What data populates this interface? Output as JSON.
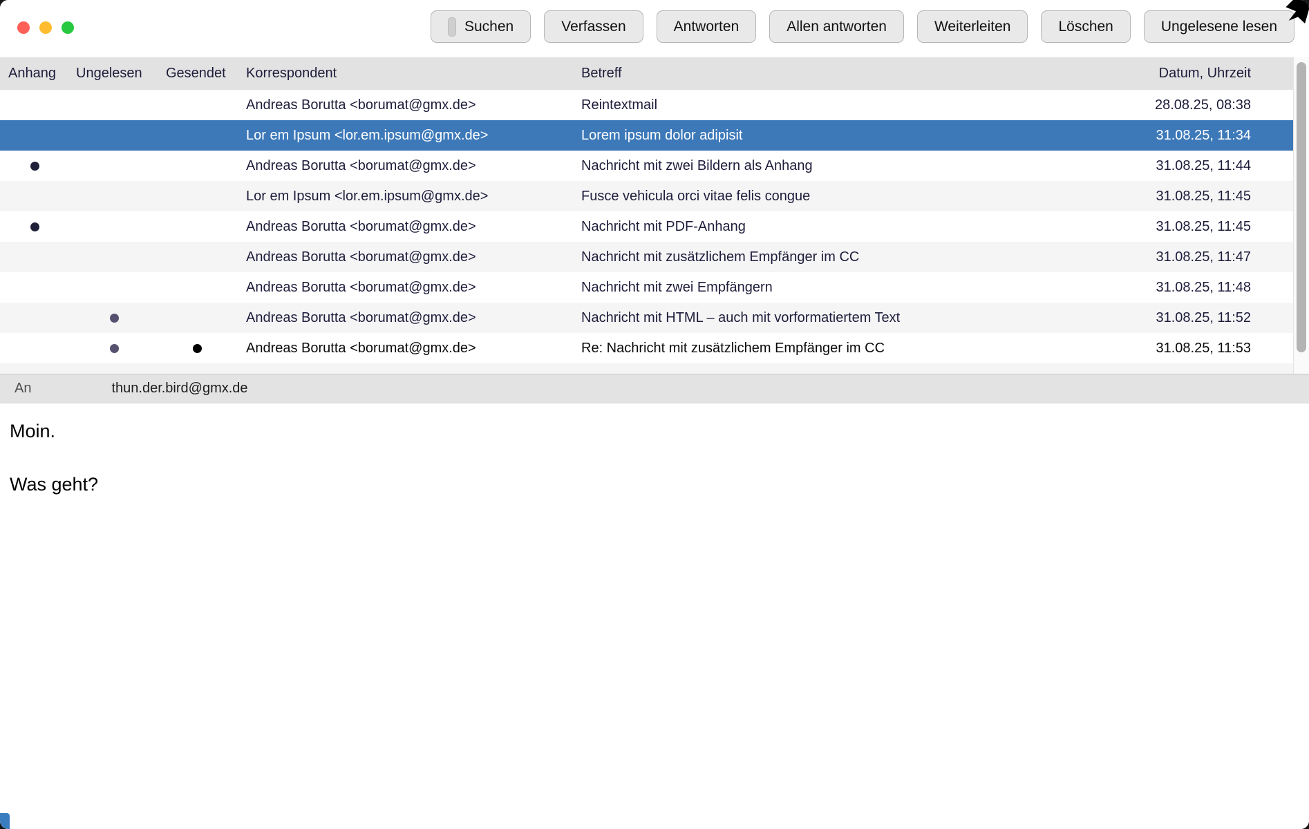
{
  "colors": {
    "selected_row": "#3d79b9",
    "header_bg": "#e2e2e2",
    "alt_row_bg": "#f5f5f6",
    "row_text": "#1d1d3b",
    "button_bg": "#e9e9e9",
    "traffic_red": "#ff5f57",
    "traffic_yellow": "#febc2e",
    "traffic_green": "#28c840",
    "unread_dot": "#55516e",
    "attachment_dot": "#20203a",
    "sent_dot": "#000000"
  },
  "toolbar": {
    "buttons": [
      {
        "id": "suchen",
        "label": "Suchen",
        "has_icon": true
      },
      {
        "id": "verfassen",
        "label": "Verfassen",
        "has_icon": false
      },
      {
        "id": "antworten",
        "label": "Antworten",
        "has_icon": false
      },
      {
        "id": "allen-antworten",
        "label": "Allen antworten",
        "has_icon": false
      },
      {
        "id": "weiterleiten",
        "label": "Weiterleiten",
        "has_icon": false
      },
      {
        "id": "loeschen",
        "label": "Löschen",
        "has_icon": false
      },
      {
        "id": "ungelesene-lesen",
        "label": "Ungelesene lesen",
        "has_icon": false
      }
    ]
  },
  "message_list": {
    "columns": [
      {
        "id": "anhang",
        "label": "Anhang"
      },
      {
        "id": "ungelesen",
        "label": "Ungelesen"
      },
      {
        "id": "gesendet",
        "label": "Gesendet"
      },
      {
        "id": "korrespondent",
        "label": "Korrespondent"
      },
      {
        "id": "betreff",
        "label": "Betreff"
      },
      {
        "id": "datum",
        "label": "Datum, Uhrzeit"
      }
    ],
    "rows": [
      {
        "anhang": false,
        "ungelesen": false,
        "gesendet": false,
        "korrespondent": "Andreas Borutta <borumat@gmx.de>",
        "betreff": "Reintextmail",
        "datum": "28.08.25, 08:38",
        "selected": false,
        "sent_style": false
      },
      {
        "anhang": false,
        "ungelesen": false,
        "gesendet": false,
        "korrespondent": "Lor em Ipsum <lor.em.ipsum@gmx.de>",
        "betreff": "Lorem ipsum dolor adipisit",
        "datum": "31.08.25, 11:34",
        "selected": true,
        "sent_style": false
      },
      {
        "anhang": true,
        "ungelesen": false,
        "gesendet": false,
        "korrespondent": "Andreas Borutta <borumat@gmx.de>",
        "betreff": "Nachricht mit zwei Bildern als Anhang",
        "datum": "31.08.25, 11:44",
        "selected": false,
        "sent_style": false
      },
      {
        "anhang": false,
        "ungelesen": false,
        "gesendet": false,
        "korrespondent": "Lor em Ipsum <lor.em.ipsum@gmx.de>",
        "betreff": "Fusce vehicula orci vitae felis congue",
        "datum": "31.08.25, 11:45",
        "selected": false,
        "sent_style": false
      },
      {
        "anhang": true,
        "ungelesen": false,
        "gesendet": false,
        "korrespondent": "Andreas Borutta <borumat@gmx.de>",
        "betreff": "Nachricht mit PDF-Anhang",
        "datum": "31.08.25, 11:45",
        "selected": false,
        "sent_style": false
      },
      {
        "anhang": false,
        "ungelesen": false,
        "gesendet": false,
        "korrespondent": "Andreas Borutta <borumat@gmx.de>",
        "betreff": "Nachricht mit zusätzlichem Empfänger im CC",
        "datum": "31.08.25, 11:47",
        "selected": false,
        "sent_style": false
      },
      {
        "anhang": false,
        "ungelesen": false,
        "gesendet": false,
        "korrespondent": "Andreas Borutta <borumat@gmx.de>",
        "betreff": "Nachricht mit zwei Empfängern",
        "datum": "31.08.25, 11:48",
        "selected": false,
        "sent_style": false
      },
      {
        "anhang": false,
        "ungelesen": true,
        "gesendet": false,
        "korrespondent": "Andreas Borutta <borumat@gmx.de>",
        "betreff": "Nachricht mit HTML – auch mit vorformatiertem Text",
        "datum": "31.08.25, 11:52",
        "selected": false,
        "sent_style": false
      },
      {
        "anhang": false,
        "ungelesen": true,
        "gesendet": true,
        "korrespondent": "Andreas Borutta <borumat@gmx.de>",
        "betreff": "Re: Nachricht mit zusätzlichem Empfänger im CC",
        "datum": "31.08.25, 11:53",
        "selected": false,
        "sent_style": true
      }
    ]
  },
  "an_bar": {
    "label": "An",
    "value": "thun.der.bird@gmx.de"
  },
  "message_body": {
    "lines": [
      "Moin.",
      "Was geht?"
    ]
  }
}
